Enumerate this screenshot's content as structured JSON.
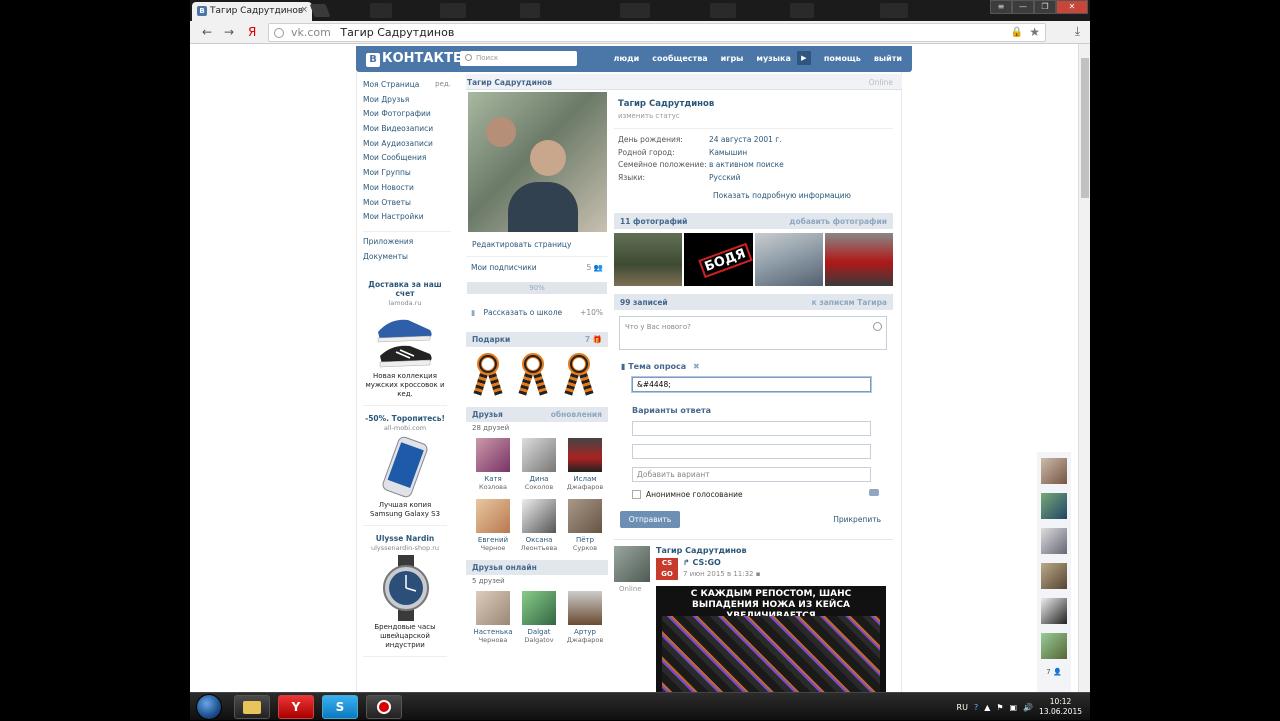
{
  "browser": {
    "tab_title": "Тагир Садрутдинов",
    "tab_favicon": "В",
    "tab_close": "×",
    "url_host": "vk.com",
    "url_title": "Тагир Садрутдинов",
    "back": "←",
    "forward": "→",
    "yandex": "Я",
    "lock": "🔒",
    "star": "★",
    "download": "⤓",
    "win_min": "—",
    "win_max": "❐",
    "win_close": "✕"
  },
  "vk": {
    "logo_letter": "В",
    "logo_text": "КОНТАКТЕ",
    "search_placeholder": "Поиск",
    "nav": [
      "люди",
      "сообщества",
      "игры",
      "музыка",
      "помощь",
      "выйти"
    ],
    "play": "▶"
  },
  "sidebar": {
    "edit": "ред.",
    "items": [
      "Моя Страница",
      "Мои Друзья",
      "Мои Фотографии",
      "Мои Видеозаписи",
      "Мои Аудиозаписи",
      "Мои Сообщения",
      "Мои Группы",
      "Мои Новости",
      "Мои Ответы",
      "Мои Настройки"
    ],
    "extra": [
      "Приложения",
      "Документы"
    ]
  },
  "ads": [
    {
      "title": "Доставка за наш счет",
      "site": "lamoda.ru",
      "text": "Новая коллекция мужских кроссовок и кед."
    },
    {
      "title": "-50%. Торопитесь!",
      "site": "all-mobi.com",
      "text": "Лучшая копия Samsung Galaxy S3"
    },
    {
      "title": "Ulysse Nardin",
      "site": "ulyssenardin-shop.ru",
      "text": "Брендовые часы швейцарской индустрии"
    }
  ],
  "profile": {
    "bar_name": "Тагир Садрутдинов",
    "online": "Online",
    "name": "Тагир Садрутдинов",
    "status": "изменить статус",
    "info": [
      {
        "k": "День рождения:",
        "v": "24 августа 2001 г."
      },
      {
        "k": "Родной город:",
        "v": "Камышин"
      },
      {
        "k": "Семейное положение:",
        "v": "в активном поиске"
      },
      {
        "k": "Языки:",
        "v": "Русский"
      }
    ],
    "more_info": "Показать подробную информацию",
    "edit_page": "Редактировать страницу",
    "followers_label": "Мои подписчики",
    "followers_count": "5",
    "progress_label": "90%",
    "progress": 0.9,
    "school_label": "Рассказать о школе",
    "school_bonus": "+10%"
  },
  "gifts": {
    "title": "Подарки",
    "count": "7"
  },
  "friends": {
    "title": "Друзья",
    "updates": "обновления",
    "count": "28 друзей",
    "list": [
      {
        "first": "Катя",
        "last": "Козлова"
      },
      {
        "first": "Дина",
        "last": "Соколов"
      },
      {
        "first": "Ислам",
        "last": "Джафаров"
      },
      {
        "first": "Евгений",
        "last": "Черное"
      },
      {
        "first": "Оксана",
        "last": "Леонтьева"
      },
      {
        "first": "Пётр",
        "last": "Сурков"
      }
    ]
  },
  "friends_online": {
    "title": "Друзья онлайн",
    "count": "5 друзей",
    "list": [
      {
        "first": "Настенька",
        "last": "Чернова"
      },
      {
        "first": "Dalgat",
        "last": "Dalgatov"
      },
      {
        "first": "Артур",
        "last": "Джафаров"
      }
    ]
  },
  "photos": {
    "title": "11 фотографий",
    "add": "добавить фотографии"
  },
  "wall": {
    "title": "99 записей",
    "link": "к записям Тагира",
    "placeholder": "Что у Вас нового?",
    "poll_title": "Тема опроса",
    "poll_value": "&#4448;",
    "variants_title": "Варианты ответа",
    "add_variant": "Добавить вариант",
    "anon": "Анонимное голосование",
    "send": "Отправить",
    "attach": "Прикрепить"
  },
  "post": {
    "author": "Тагир Садрутдинов",
    "online": "Online",
    "group_logo": "CS GO",
    "group": "CS:GO",
    "date": "7 июн 2015 в 11:32",
    "image_caption": "С КАЖДЫМ РЕПОСТОМ, ШАНС ВЫПАДЕНИЯ НОЖА ИЗ КЕЙСА УВЕЛИЧИВАЕТСЯ"
  },
  "ministrip": {
    "count": "7"
  },
  "taskbar": {
    "apps": [
      "explorer",
      "yandex",
      "skype",
      "recorder"
    ],
    "yandex_glyph": "Y",
    "skype_glyph": "S",
    "lang": "RU",
    "time": "10:12",
    "date": "13.06.2015"
  }
}
